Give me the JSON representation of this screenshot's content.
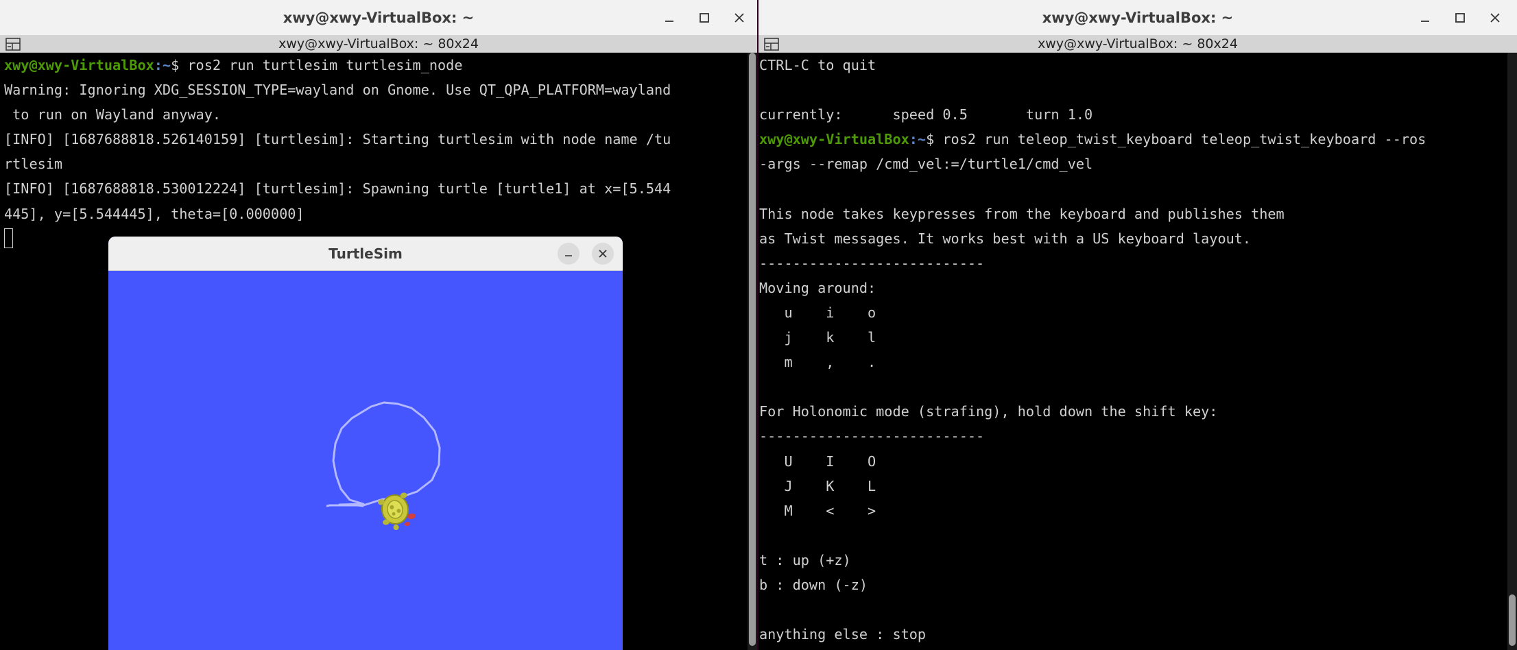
{
  "left_window": {
    "title": "xwy@xwy-VirtualBox: ~",
    "tab_title": "xwy@xwy-VirtualBox: ~ 80x24",
    "lines": [
      {
        "type": "prompt",
        "user": "xwy@xwy-VirtualBox",
        "path": ":~",
        "cmd": "$ ros2 run turtlesim turtlesim_node"
      },
      {
        "type": "text",
        "text": "Warning: Ignoring XDG_SESSION_TYPE=wayland on Gnome. Use QT_QPA_PLATFORM=wayland"
      },
      {
        "type": "text",
        "text": " to run on Wayland anyway."
      },
      {
        "type": "text",
        "text": "[INFO] [1687688818.526140159] [turtlesim]: Starting turtlesim with node name /tu"
      },
      {
        "type": "text",
        "text": "rtlesim"
      },
      {
        "type": "text",
        "text": "[INFO] [1687688818.530012224] [turtlesim]: Spawning turtle [turtle1] at x=[5.544"
      },
      {
        "type": "text",
        "text": "445], y=[5.544445], theta=[0.000000]"
      },
      {
        "type": "cursor"
      }
    ]
  },
  "right_window": {
    "title": "xwy@xwy-VirtualBox: ~",
    "tab_title": "xwy@xwy-VirtualBox: ~ 80x24",
    "lines": [
      {
        "type": "text",
        "text": "CTRL-C to quit"
      },
      {
        "type": "text",
        "text": ""
      },
      {
        "type": "text",
        "text": "currently:      speed 0.5       turn 1.0"
      },
      {
        "type": "prompt",
        "user": "xwy@xwy-VirtualBox",
        "path": ":~",
        "cmd": "$ ros2 run teleop_twist_keyboard teleop_twist_keyboard --ros"
      },
      {
        "type": "text",
        "text": "-args --remap /cmd_vel:=/turtle1/cmd_vel"
      },
      {
        "type": "text",
        "text": ""
      },
      {
        "type": "text",
        "text": "This node takes keypresses from the keyboard and publishes them"
      },
      {
        "type": "text",
        "text": "as Twist messages. It works best with a US keyboard layout."
      },
      {
        "type": "text",
        "text": "---------------------------"
      },
      {
        "type": "text",
        "text": "Moving around:"
      },
      {
        "type": "text",
        "text": "   u    i    o"
      },
      {
        "type": "text",
        "text": "   j    k    l"
      },
      {
        "type": "text",
        "text": "   m    ,    ."
      },
      {
        "type": "text",
        "text": ""
      },
      {
        "type": "text",
        "text": "For Holonomic mode (strafing), hold down the shift key:"
      },
      {
        "type": "text",
        "text": "---------------------------"
      },
      {
        "type": "text",
        "text": "   U    I    O"
      },
      {
        "type": "text",
        "text": "   J    K    L"
      },
      {
        "type": "text",
        "text": "   M    <    >"
      },
      {
        "type": "text",
        "text": ""
      },
      {
        "type": "text",
        "text": "t : up (+z)"
      },
      {
        "type": "text",
        "text": "b : down (-z)"
      },
      {
        "type": "text",
        "text": ""
      },
      {
        "type": "text",
        "text": "anything else : stop"
      }
    ]
  },
  "turtlesim": {
    "title": "TurtleSim",
    "background": "#4556ff",
    "pen_color": "#b3b8ff",
    "turtle_color": "#c8c83a"
  },
  "colors": {
    "prompt_user": "#4e9a06",
    "prompt_path": "#5b85c8",
    "terminal_text": "#d0d0d0",
    "terminal_bg": "#000000",
    "desktop_bg": "#2c001e"
  },
  "icons": [
    "minimize-icon",
    "maximize-icon",
    "close-icon",
    "new-tab-icon"
  ]
}
